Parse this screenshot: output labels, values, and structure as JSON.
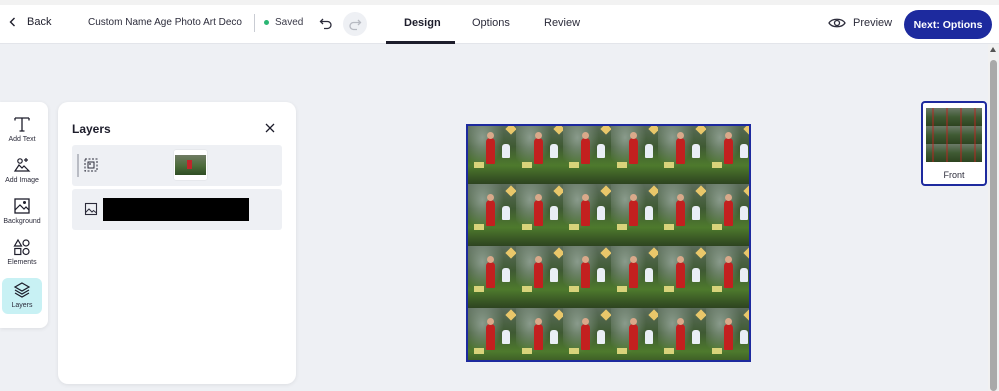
{
  "header": {
    "back_label": "Back",
    "doc_title": "Custom Name Age Photo Art Deco Birth...",
    "saved_label": "Saved",
    "tabs": [
      {
        "label": "Design",
        "active": true
      },
      {
        "label": "Options",
        "active": false
      },
      {
        "label": "Review",
        "active": false
      }
    ],
    "preview_label": "Preview",
    "next_label": "Next: Options"
  },
  "toolbar": {
    "items": [
      {
        "label": "Add Text",
        "icon": "text-icon"
      },
      {
        "label": "Add Image",
        "icon": "image-add-icon"
      },
      {
        "label": "Background",
        "icon": "background-icon"
      },
      {
        "label": "Elements",
        "icon": "shapes-icon"
      },
      {
        "label": "Layers",
        "icon": "layers-icon",
        "active": true
      }
    ]
  },
  "layers_panel": {
    "title": "Layers",
    "layers": [
      {
        "type": "photo-pattern",
        "icon": "pattern-icon"
      },
      {
        "type": "image",
        "icon": "image-icon",
        "redacted": true
      }
    ]
  },
  "pages": [
    {
      "label": "Front",
      "selected": true
    }
  ],
  "colors": {
    "brand": "#1d2a9e",
    "active_tool": "#c8f1f4",
    "saved_dot": "#2bb673",
    "background": "#eef0f4"
  }
}
